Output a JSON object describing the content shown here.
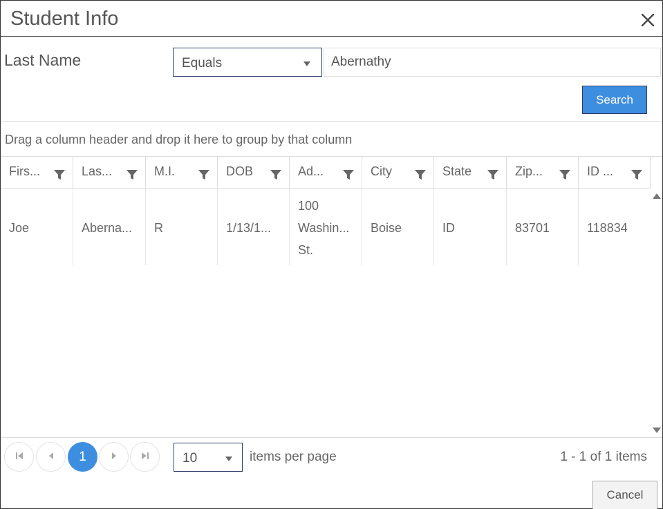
{
  "dialog": {
    "title": "Student Info",
    "close_icon": "close-icon"
  },
  "filter": {
    "label": "Last Name",
    "operator": "Equals",
    "value": "Abernathy",
    "search_label": "Search"
  },
  "grid": {
    "group_hint": "Drag a column header and drop it here to group by that column",
    "columns": [
      {
        "label": "Firs..."
      },
      {
        "label": "Las..."
      },
      {
        "label": "M.I."
      },
      {
        "label": "DOB"
      },
      {
        "label": "Ad..."
      },
      {
        "label": "City"
      },
      {
        "label": "State"
      },
      {
        "label": "Zip..."
      },
      {
        "label": "ID ..."
      }
    ],
    "rows": [
      {
        "first": "Joe",
        "last": "Aberna...",
        "mi": "R",
        "dob": "1/13/1...",
        "address_line1": "100",
        "address_line2": "Washin...",
        "address_line3": "St.",
        "city": "Boise",
        "state": "ID",
        "zip": "83701",
        "id": "118834"
      }
    ]
  },
  "pager": {
    "current_page": "1",
    "page_size": "10",
    "items_per_page_label": "items per page",
    "info": "1 - 1 of 1 items"
  },
  "footer": {
    "cancel_label": "Cancel"
  },
  "colors": {
    "accent": "#3e8ee0",
    "border_dark": "#2b3a67"
  }
}
